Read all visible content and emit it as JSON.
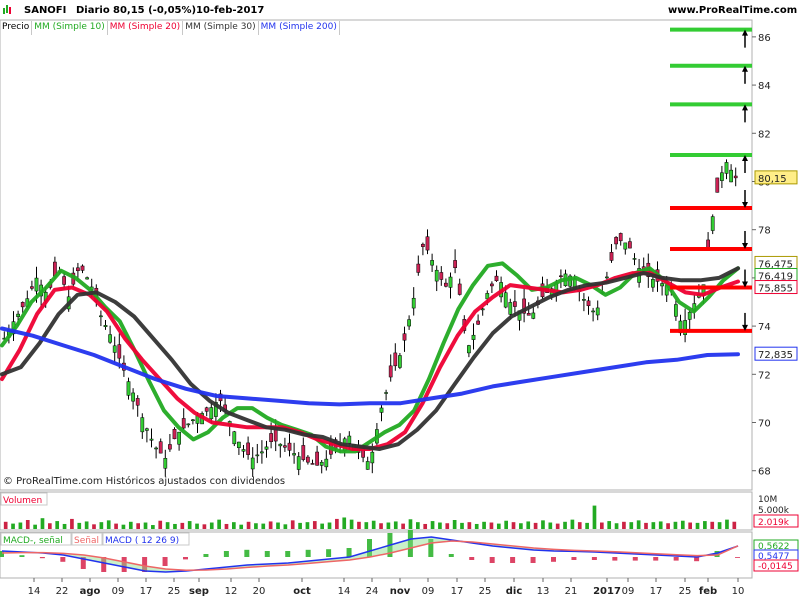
{
  "header": {
    "symbol": "SANOFI",
    "period": "Diario",
    "quote": "80,15 (-0,05%)",
    "date": "10-feb-2017",
    "site": "www.ProRealTime.com"
  },
  "legend": {
    "items": [
      {
        "label": "Precio",
        "color": "#000000"
      },
      {
        "label": "MM (Simple 10)",
        "color": "#22aa22"
      },
      {
        "label": "MM (Simple 20)",
        "color": "#ee0033"
      },
      {
        "label": "MM (Simple 30)",
        "color": "#333333"
      },
      {
        "label": "MM (Simple 200)",
        "color": "#2233ee"
      }
    ]
  },
  "copyright": "© ProRealTime.com Históricos ajustados con dividendos",
  "chart_data": [
    {
      "type": "candlestick",
      "title": "SANOFI Diario",
      "ylim": [
        67.2,
        86.7
      ],
      "yticks": [
        68,
        70,
        72,
        74,
        76,
        78,
        80,
        82,
        84,
        86
      ],
      "ytick_labels": [
        "68",
        "70",
        "72",
        "74",
        "76",
        "78",
        "80",
        "82",
        "84",
        "86"
      ],
      "xticks": [
        "14",
        "22",
        "ago",
        "09",
        "17",
        "25",
        "sep",
        "12",
        "20",
        "oct",
        "14",
        "24",
        "nov",
        "09",
        "17",
        "25",
        "dic",
        "13",
        "21",
        "2017",
        "09",
        "17",
        "25",
        "feb",
        "10"
      ],
      "close_path": [
        73.5,
        74.3,
        75.0,
        76.0,
        75.3,
        76.4,
        75.2,
        76.5,
        75.8,
        74.4,
        73.5,
        72.3,
        71.2,
        70.0,
        69.0,
        68.5,
        69.5,
        69.9,
        70.3,
        70.5,
        71.0,
        70.0,
        69.0,
        68.5,
        68.8,
        69.3,
        69.0,
        68.7,
        68.4,
        68.2,
        68.5,
        69.0,
        69.5,
        68.7,
        68.3,
        70.5,
        72.0,
        73.0,
        75.0,
        77.5,
        76.5,
        75.6,
        76.5,
        73.0,
        74.0,
        75.5,
        76.0,
        75.0,
        74.6,
        74.4,
        75.2,
        75.6,
        76.2,
        76.0,
        75.0,
        74.5,
        76.0,
        77.6,
        77.4,
        76.4,
        76.0,
        75.8,
        75.6,
        74.0,
        74.8,
        75.7,
        79.0,
        80.9,
        80.15
      ],
      "series": [
        {
          "name": "MM (Simple 10)",
          "color": "#22aa22",
          "values": [
            73.2,
            74.0,
            75.0,
            75.6,
            76.3,
            76.0,
            75.5,
            74.8,
            74.2,
            73.0,
            71.7,
            70.5,
            69.8,
            69.3,
            69.6,
            70.2,
            70.6,
            70.6,
            70.2,
            69.9,
            69.7,
            69.5,
            69.0,
            68.8,
            68.8,
            69.2,
            69.6,
            69.9,
            70.5,
            71.8,
            73.3,
            74.7,
            75.7,
            76.5,
            76.6,
            76.1,
            75.5,
            75.6,
            75.9,
            76.0,
            75.7,
            75.3,
            75.6,
            76.2,
            76.4,
            75.9,
            75.0,
            74.6,
            75.2,
            75.9,
            76.4
          ]
        },
        {
          "name": "MM (Simple 20)",
          "color": "#ee0033",
          "values": [
            71.8,
            73.0,
            74.5,
            75.5,
            75.6,
            75.3,
            74.6,
            73.5,
            72.6,
            71.8,
            71.0,
            70.4,
            70.0,
            69.9,
            69.8,
            69.8,
            69.8,
            69.6,
            69.3,
            69.1,
            68.9,
            68.9,
            69.1,
            69.6,
            70.8,
            72.3,
            73.6,
            74.6,
            75.2,
            75.7,
            75.6,
            75.5,
            75.4,
            75.5,
            75.7,
            76.0,
            76.2,
            76.2,
            75.8,
            75.4,
            75.3,
            75.6,
            75.85
          ]
        },
        {
          "name": "MM (Simple 30)",
          "color": "#333333",
          "values": [
            72.0,
            72.3,
            73.3,
            74.5,
            75.3,
            75.4,
            75.0,
            74.4,
            73.5,
            72.6,
            71.6,
            70.9,
            70.4,
            70.1,
            69.8,
            69.7,
            69.5,
            69.4,
            69.1,
            69.0,
            68.9,
            69.1,
            69.7,
            70.5,
            71.6,
            72.7,
            73.7,
            74.4,
            74.8,
            75.2,
            75.5,
            75.7,
            75.8,
            76.0,
            76.2,
            76.0,
            75.9,
            75.9,
            76.0,
            76.4
          ]
        },
        {
          "name": "MM (Simple 200)",
          "color": "#2233ee",
          "values": [
            73.9,
            73.6,
            73.2,
            72.8,
            72.3,
            71.8,
            71.4,
            71.1,
            71.0,
            70.9,
            70.8,
            70.75,
            70.8,
            70.8,
            71.0,
            71.2,
            71.5,
            71.7,
            71.9,
            72.1,
            72.3,
            72.5,
            72.6,
            72.8,
            72.835
          ]
        }
      ],
      "levels": {
        "green": [
          86.3,
          84.8,
          83.2,
          81.1
        ],
        "red": [
          78.9,
          77.2,
          75.6,
          73.8
        ]
      },
      "price_labels": [
        {
          "text": "80,15",
          "color": "#000000",
          "bg": "#ffee88"
        },
        {
          "text": "76,475",
          "color": "#000000",
          "bg": "#ffffff"
        },
        {
          "text": "76,419",
          "color": "#22aa22",
          "bg": "#ffffff"
        },
        {
          "text": "75,855",
          "color": "#ee0033",
          "bg": "#ffffff"
        },
        {
          "text": "72,835",
          "color": "#2233ee",
          "bg": "#ffffff"
        }
      ]
    },
    {
      "type": "bar",
      "title": "Volumen",
      "ytick_labels": [
        "10M",
        "5.000k"
      ],
      "last_label": "2.019k",
      "values": [
        2.0,
        1.5,
        1.8,
        2.5,
        1.2,
        3.0,
        1.6,
        2.2,
        1.4,
        2.8,
        1.7,
        2.1,
        1.3,
        1.9,
        2.4,
        1.5,
        1.2,
        2.0,
        1.6,
        1.8,
        1.1,
        2.3,
        1.9,
        1.4,
        1.7,
        2.2,
        1.5,
        1.3,
        1.8,
        2.6,
        1.4,
        1.9,
        1.2,
        2.0,
        1.6,
        1.5,
        2.1,
        1.8,
        1.3,
        2.4,
        1.7,
        1.9,
        2.2,
        1.5,
        1.8,
        2.8,
        3.2,
        2.6,
        2.0,
        1.9,
        2.3,
        1.6,
        1.8,
        2.1,
        1.5,
        2.7,
        1.9,
        1.4,
        2.2,
        1.8,
        1.6,
        2.5,
        1.7,
        1.9,
        1.4,
        2.0,
        1.8,
        1.5,
        2.3,
        1.9,
        1.6,
        2.1,
        1.7,
        2.4,
        1.8,
        1.5,
        2.0,
        2.6,
        1.9,
        1.7,
        6.5,
        1.8,
        2.2,
        1.6,
        2.0,
        1.9,
        2.4,
        1.7,
        1.9,
        2.1,
        1.6,
        2.0,
        2.3,
        1.8,
        1.7,
        2.2,
        2.0,
        1.9,
        2.6,
        2.019
      ]
    },
    {
      "type": "line",
      "title": "MACD-, señal",
      "legend": [
        "MACD-, señal",
        "Señal",
        "MACD ( 12 26 9)"
      ],
      "value_labels": [
        "0,5622",
        "0,5477",
        "-0,0145"
      ],
      "series": [
        {
          "name": "MACD",
          "color": "#2233ee",
          "values": [
            0.3,
            0.25,
            0.2,
            0.1,
            -0.1,
            -0.3,
            -0.5,
            -0.7,
            -0.75,
            -0.7,
            -0.6,
            -0.5,
            -0.4,
            -0.35,
            -0.3,
            -0.2,
            -0.1,
            0.0,
            0.3,
            0.6,
            0.9,
            1.0,
            0.85,
            0.7,
            0.55,
            0.45,
            0.35,
            0.3,
            0.28,
            0.25,
            0.2,
            0.15,
            0.1,
            0.05,
            0.0,
            0.2,
            0.5477
          ]
        },
        {
          "name": "Señal",
          "color": "#ee6666",
          "values": [
            0.2,
            0.22,
            0.22,
            0.18,
            0.1,
            -0.05,
            -0.25,
            -0.45,
            -0.6,
            -0.66,
            -0.65,
            -0.6,
            -0.52,
            -0.45,
            -0.4,
            -0.32,
            -0.23,
            -0.15,
            0.0,
            0.2,
            0.45,
            0.7,
            0.8,
            0.75,
            0.65,
            0.55,
            0.45,
            0.38,
            0.33,
            0.3,
            0.26,
            0.21,
            0.16,
            0.11,
            0.07,
            0.1,
            0.5622
          ]
        }
      ]
    }
  ]
}
